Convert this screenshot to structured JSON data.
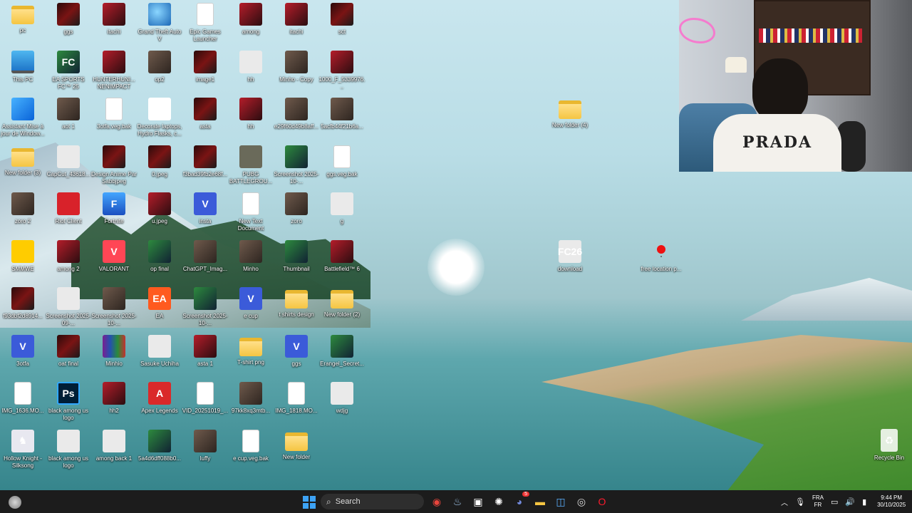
{
  "desktop": {
    "icons": [
      {
        "label": "pc",
        "glyph": "",
        "style": "g-folder"
      },
      {
        "label": "ggs",
        "glyph": "",
        "style": "g-img-dark"
      },
      {
        "label": "itachi",
        "glyph": "",
        "style": "g-img-red"
      },
      {
        "label": "Grand Theft Auto V",
        "glyph": "",
        "style": "g-globe"
      },
      {
        "label": "Epic Games Launcher",
        "glyph": "",
        "style": "g-doc"
      },
      {
        "label": "among",
        "glyph": "",
        "style": "g-img-red"
      },
      {
        "label": "itachi",
        "glyph": "",
        "style": "g-img-red"
      },
      {
        "label": "sct",
        "glyph": "",
        "style": "g-img-dark"
      },
      {
        "label": "This PC",
        "glyph": "",
        "style": "g-pc"
      },
      {
        "label": "EA SPORTS FC™ 25",
        "glyph": "FC",
        "style": "g-img-green"
      },
      {
        "label": "HUNTERHUNI... NENIMPACT",
        "glyph": "",
        "style": "g-img-red"
      },
      {
        "label": "op2",
        "glyph": "",
        "style": "g-img-photo"
      },
      {
        "label": "image1",
        "glyph": "",
        "style": "g-img-dark"
      },
      {
        "label": "hh",
        "glyph": "",
        "style": "g-light"
      },
      {
        "label": "Minho - Copy",
        "glyph": "",
        "style": "g-img-photo"
      },
      {
        "label": "1000_F_5339976...",
        "glyph": "",
        "style": "g-img-red"
      },
      {
        "label": "Assistant Mise à jour de Window...",
        "glyph": "",
        "style": "g-win"
      },
      {
        "label": "aot 1",
        "glyph": "",
        "style": "g-img-photo"
      },
      {
        "label": "3otfa.veg.bak",
        "glyph": "",
        "style": "g-doc"
      },
      {
        "label": "Decorate laptops, Hydro Flasks, c...",
        "glyph": "☠",
        "style": "g-skull"
      },
      {
        "label": "asta",
        "glyph": "",
        "style": "g-img-dark"
      },
      {
        "label": "hh",
        "glyph": "",
        "style": "g-img-red"
      },
      {
        "label": "e29f60d49b8aff...",
        "glyph": "",
        "style": "g-img-photo"
      },
      {
        "label": "5acfb44f21b6a...",
        "glyph": "",
        "style": "g-img-photo"
      },
      {
        "label": "New folder (3)",
        "glyph": "",
        "style": "g-folder"
      },
      {
        "label": "CapCut_43618...",
        "glyph": "",
        "style": "g-light"
      },
      {
        "label": "Design Anime Par Sabbjpeg",
        "glyph": "",
        "style": "g-img-dark"
      },
      {
        "label": "0.jpeg",
        "glyph": "",
        "style": "g-img-dark"
      },
      {
        "label": "f3bad39fb2e68f...",
        "glyph": "",
        "style": "g-img-dark"
      },
      {
        "label": "PUBG BATTLEGROU...",
        "glyph": "",
        "style": "g-pubg"
      },
      {
        "label": "Screenshot 2025-10-...",
        "glyph": "",
        "style": "g-img-green"
      },
      {
        "label": "ggs.veg.bak",
        "glyph": "",
        "style": "g-doc"
      },
      {
        "label": "zoro 2",
        "glyph": "",
        "style": "g-img-photo"
      },
      {
        "label": "Riot Client",
        "glyph": "",
        "style": "g-riot"
      },
      {
        "label": "Fortnite",
        "glyph": "F",
        "style": "g-fortnite"
      },
      {
        "label": "u.jpeg",
        "glyph": "",
        "style": "g-img-red"
      },
      {
        "label": "insta",
        "glyph": "V",
        "style": "g-blue-v"
      },
      {
        "label": "New Text Document",
        "glyph": "",
        "style": "g-doc"
      },
      {
        "label": "zoro",
        "glyph": "",
        "style": "g-img-photo"
      },
      {
        "label": "g",
        "glyph": "",
        "style": "g-light"
      },
      {
        "label": "SMMWE",
        "glyph": "",
        "style": "g-yellow"
      },
      {
        "label": "among 2",
        "glyph": "",
        "style": "g-img-red"
      },
      {
        "label": "VALORANT",
        "glyph": "V",
        "style": "g-valorant"
      },
      {
        "label": "op final",
        "glyph": "",
        "style": "g-img-green"
      },
      {
        "label": "ChatGPT_Imag...",
        "glyph": "",
        "style": "g-img-photo"
      },
      {
        "label": "Minho",
        "glyph": "",
        "style": "g-img-photo"
      },
      {
        "label": "Thumbnail",
        "glyph": "",
        "style": "g-img-green"
      },
      {
        "label": "Battlefield™ 6",
        "glyph": "",
        "style": "g-img-red"
      },
      {
        "label": "f93dbf2d8914...",
        "glyph": "",
        "style": "g-img-dark"
      },
      {
        "label": "Screenshot 2025-09-...",
        "glyph": "",
        "style": "g-light"
      },
      {
        "label": "Screenshot 2025-10-...",
        "glyph": "",
        "style": "g-img-photo"
      },
      {
        "label": "EA",
        "glyph": "EA",
        "style": "g-ea"
      },
      {
        "label": "Screenshot 2025-10-...",
        "glyph": "",
        "style": "g-img-green"
      },
      {
        "label": "e cup",
        "glyph": "V",
        "style": "g-blue-v"
      },
      {
        "label": "t shirts design",
        "glyph": "",
        "style": "g-folder"
      },
      {
        "label": "New folder (2)",
        "glyph": "",
        "style": "g-folder"
      },
      {
        "label": "3otfa",
        "glyph": "V",
        "style": "g-blue-v"
      },
      {
        "label": "oat final",
        "glyph": "",
        "style": "g-img-dark"
      },
      {
        "label": "Minhio",
        "glyph": "",
        "style": "g-winrar"
      },
      {
        "label": "Sasuke Uchiha",
        "glyph": "",
        "style": "g-light"
      },
      {
        "label": "asta 1",
        "glyph": "",
        "style": "g-img-red"
      },
      {
        "label": "T-shirt png",
        "glyph": "",
        "style": "g-folder"
      },
      {
        "label": "ggs",
        "glyph": "V",
        "style": "g-blue-v"
      },
      {
        "label": "Erangel_Secret...",
        "glyph": "",
        "style": "g-img-green"
      },
      {
        "label": "IMG_1636.MO...",
        "glyph": "",
        "style": "g-doc"
      },
      {
        "label": "black among us logo",
        "glyph": "Ps",
        "style": "g-ps"
      },
      {
        "label": "hh2",
        "glyph": "",
        "style": "g-img-red"
      },
      {
        "label": "Apex Legends",
        "glyph": "A",
        "style": "g-apex"
      },
      {
        "label": "VID_20251019_...",
        "glyph": "",
        "style": "g-doc"
      },
      {
        "label": "97kk8xq3mtb...",
        "glyph": "",
        "style": "g-img-photo"
      },
      {
        "label": "IMG_1818.MO...",
        "glyph": "",
        "style": "g-doc"
      },
      {
        "label": "wdjg",
        "glyph": "",
        "style": "g-light"
      },
      {
        "label": "Hollow Knight - Silksong",
        "glyph": "♞",
        "style": "g-hollow"
      },
      {
        "label": "black among us logo",
        "glyph": "",
        "style": "g-light"
      },
      {
        "label": "among back 1",
        "glyph": "",
        "style": "g-light"
      },
      {
        "label": "5a4d6dff088b0...",
        "glyph": "",
        "style": "g-img-green"
      },
      {
        "label": "luffy",
        "glyph": "",
        "style": "g-img-photo"
      },
      {
        "label": "e cup.veg.bak",
        "glyph": "",
        "style": "g-doc"
      },
      {
        "label": "New folder",
        "glyph": "",
        "style": "g-folder"
      }
    ],
    "extra_icons": [
      {
        "id": "new-folder-4",
        "label": "New folder (4)",
        "glyph": "",
        "style": "g-folder"
      },
      {
        "id": "download",
        "label": "download",
        "glyph": "FC26",
        "style": "g-light"
      },
      {
        "id": "free-location",
        "label": "free location p...",
        "glyph": "",
        "style": "g-light"
      },
      {
        "id": "recycle-bin",
        "label": "Recycle Bin",
        "glyph": "♻",
        "style": "g-recycle"
      }
    ]
  },
  "webcam": {
    "shirt_text": "PRADA"
  },
  "taskbar": {
    "search_placeholder": "Search",
    "lang_top": "FRA",
    "lang_bottom": "FR",
    "time": "9:44 PM",
    "date": "30/10/2025",
    "notification_badge": "5",
    "pinned": [
      {
        "name": "chrome-icon",
        "glyph": "◉",
        "color": "#e8453c"
      },
      {
        "name": "steam-icon",
        "glyph": "♨",
        "color": "#9fc4e8"
      },
      {
        "name": "capcut-icon",
        "glyph": "▣",
        "color": "#ffffff"
      },
      {
        "name": "chatgpt-icon",
        "glyph": "✺",
        "color": "#ffffff"
      },
      {
        "name": "discord-icon",
        "glyph": "◕",
        "color": "#7289da"
      },
      {
        "name": "file-explorer-icon",
        "glyph": "▬",
        "color": "#f5c542"
      },
      {
        "name": "vegas-icon",
        "glyph": "◫",
        "color": "#5ab0ff"
      },
      {
        "name": "obs-icon",
        "glyph": "◎",
        "color": "#dddddd"
      },
      {
        "name": "opera-icon",
        "glyph": "O",
        "color": "#ff1b2d"
      }
    ]
  }
}
